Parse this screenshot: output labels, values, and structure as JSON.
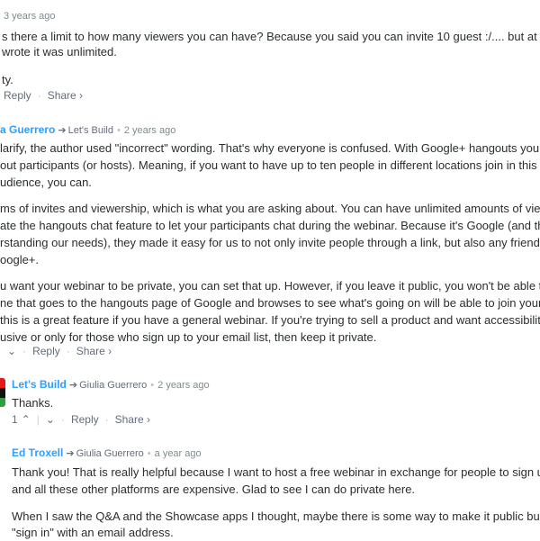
{
  "comments": [
    {
      "meta_time": "3 years ago",
      "lines": [
        "s there a limit to how many viewers you can have? Because you said you can invite 10 guest :/.... but at the b",
        "wrote it was unlimited."
      ],
      "line2": "ty.",
      "reply": "Reply",
      "share": "Share ›"
    },
    {
      "author": "a Guerrero",
      "parent": "Let's Build",
      "time": "2 years ago",
      "para1": [
        "larify, the author used \"incorrect\" wording. That's why everyone is confused. With Google+ hangouts you can",
        "out participants (or hosts). Meaning, if you want to have up to ten people in different locations join in this web",
        "udience, you can."
      ],
      "para2": [
        "ms of invites and viewership, which is what you are asking about. You can have unlimited amounts of viewe",
        "ate the hangouts chat feature to let your participants chat during the webinar. Because it's Google (and they'",
        "rstanding our needs), they made it easy for us to not only invite people through a link, but also any friends ar",
        "oogle+."
      ],
      "para3": [
        "u want your webinar to be private, you can set that up. However, if you leave it public, you won't be able to in",
        "ne that goes to the hangouts page of Google and browses to see what's going on will be able to join your we",
        " this is a great feature if you have a general webinar. If you're trying to sell a product and want accessibility t",
        "usive or only for those who sign up to your email list, then keep it private."
      ],
      "reply": "Reply",
      "share": "Share ›"
    },
    {
      "author": "Let's Build",
      "parent": "Giulia Guerrero",
      "time": "2 years ago",
      "text": "Thanks.",
      "upvotes": "1",
      "reply": "Reply",
      "share": "Share ›"
    },
    {
      "author": "Ed Troxell",
      "parent": "Giulia Guerrero",
      "time": "a year ago",
      "para1": [
        "Thank you! That is really helpful because I want to host a free webinar in exchange for people to sign up f",
        "and all these other platforms are expensive. Glad to see I can do private here."
      ],
      "para2": [
        "When I saw the Q&A and the Showcase apps I thought, maybe there is some way to make it public but re",
        "\"sign in\" with an email address."
      ]
    }
  ],
  "icons": {
    "arrow": "share-arrow-icon",
    "upvote": "upvote-icon",
    "downvote": "downvote-icon"
  },
  "colors": {
    "author": "#2e9fff",
    "meta": "#7f8c8d",
    "text": "#2a2e2e",
    "avatar_red": "#e21a1a",
    "avatar_green": "#2e9e3e",
    "avatar_black": "#111111"
  }
}
